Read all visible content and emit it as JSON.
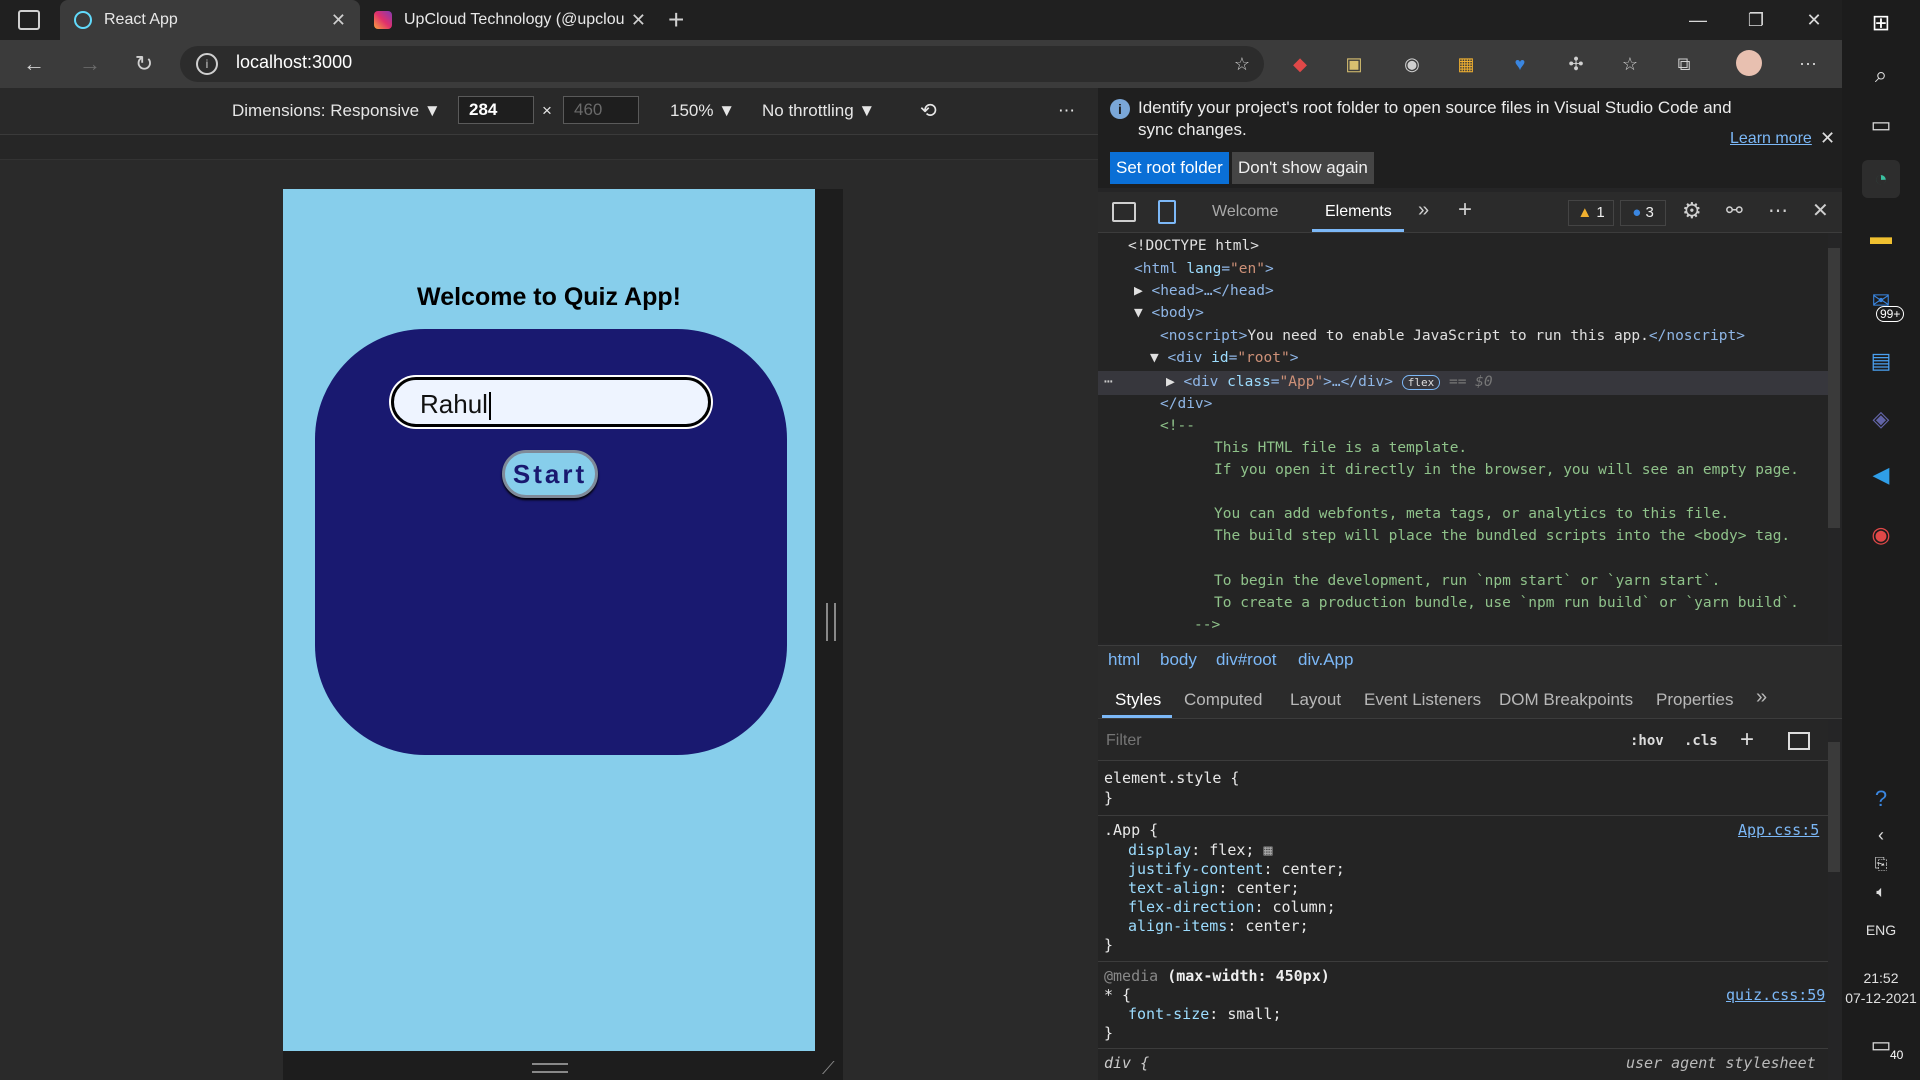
{
  "browser": {
    "tabs": [
      {
        "title": "React App",
        "active": true
      },
      {
        "title": "UpCloud Technology (@upcloud",
        "active": false
      }
    ],
    "url": "localhost:3000"
  },
  "device_toolbar": {
    "dimensions_label": "Dimensions: Responsive",
    "width": "284",
    "height_placeholder": "460",
    "times": "×",
    "zoom": "150%",
    "throttling": "No throttling",
    "more": "⋯"
  },
  "app": {
    "heading": "Welcome to Quiz App!",
    "name_value": "Rahul",
    "start_label": "Start"
  },
  "devtools": {
    "info_message": "Identify your project's root folder to open source files in Visual Studio Code and sync changes.",
    "learn_more": "Learn more",
    "set_root_button": "Set root folder",
    "dont_show_button": "Don't show again",
    "tabs": [
      "Welcome",
      "Elements"
    ],
    "warnings": "1",
    "messages": "3",
    "dom_lines": {
      "doctype": "<!DOCTYPE html>",
      "html_open_tag": "<html",
      "html_attr": "lang",
      "html_attr_val": "\"en\"",
      "head": "<head>…</head>",
      "body": "<body>",
      "noscript_open": "<noscript>",
      "noscript_text": "You need to enable JavaScript to run this app.",
      "noscript_close": "</noscript>",
      "div_root_tag": "<div",
      "div_root_attr": "id",
      "div_root_val": "\"root\"",
      "div_app_tag": "<div",
      "div_app_attr": "class",
      "div_app_val": "\"App\"",
      "div_app_rest": ">…</div>",
      "flex_badge": "flex",
      "eq_s0": "== $0",
      "div_close": "</div>",
      "comment_open": "<!--",
      "c1": "This HTML file is a template.",
      "c2": "If you open it directly in the browser, you will see an empty page.",
      "c3": "You can add webfonts, meta tags, or analytics to this file.",
      "c4": "The build step will place the bundled scripts into the <body> tag.",
      "c5": "To begin the development, run `npm start` or `yarn start`.",
      "c6": "To create a production bundle, use `npm run build` or `yarn build`.",
      "comment_close": "-->"
    },
    "breadcrumbs": [
      "html",
      "body",
      "div#root",
      "div.App"
    ],
    "style_tabs": [
      "Styles",
      "Computed",
      "Layout",
      "Event Listeners",
      "DOM Breakpoints",
      "Properties"
    ],
    "filter_placeholder": "Filter",
    "hov": ":hov",
    "cls": ".cls",
    "styles": {
      "element_style": "element.style {",
      "close_brace": "}",
      "app_selector": ".App {",
      "app_source": "App.css:5",
      "app_props": [
        {
          "name": "display",
          "value": "flex;"
        },
        {
          "name": "justify-content",
          "value": "center;"
        },
        {
          "name": "text-align",
          "value": "center;"
        },
        {
          "name": "flex-direction",
          "value": "column;"
        },
        {
          "name": "align-items",
          "value": "center;"
        }
      ],
      "media_at": "@media",
      "media_query": "(max-width: 450px)",
      "star_selector": "* {",
      "quiz_source": "quiz.css:59",
      "font_size_prop": "font-size",
      "font_size_val": "small;",
      "div_selector": "div {",
      "user_agent": "user agent stylesheet"
    }
  },
  "taskbar": {
    "mail_badge": "99+",
    "lang": "ENG",
    "time": "21:52",
    "date": "07-12-2021",
    "notif_count": "40"
  }
}
